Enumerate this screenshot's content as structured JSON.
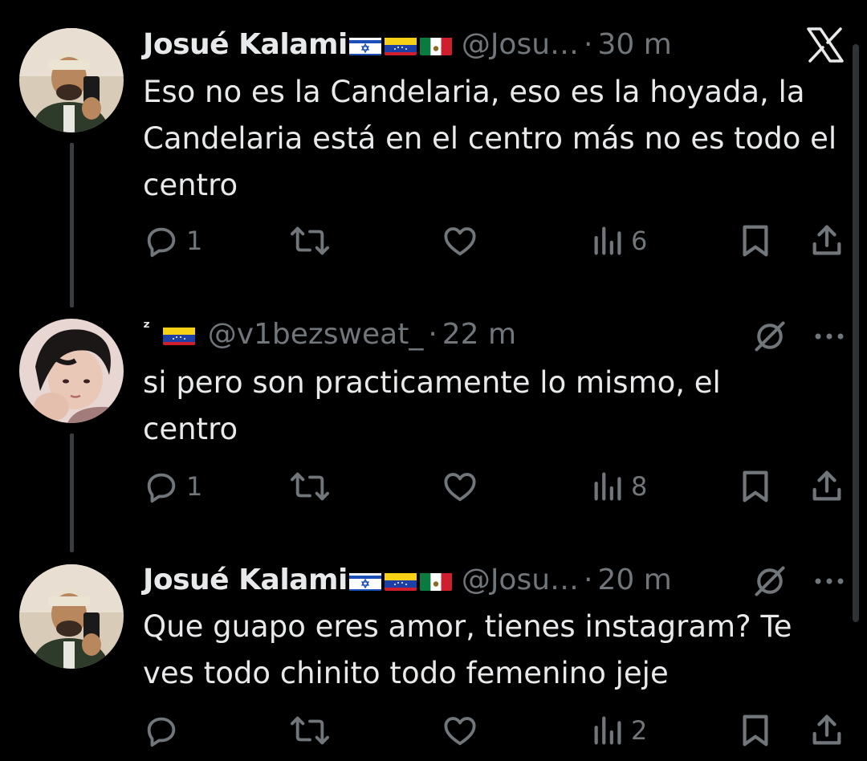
{
  "tweets": [
    {
      "name": "Josué Kalami",
      "handle": "@Josu…",
      "dot": "·",
      "time": "30 m",
      "text": "Eso no es la Candelaria, eso es la hoyada, la Candelaria está en el centro más no es todo el centro",
      "replies": "1",
      "retweets": "",
      "likes": "",
      "views": "6"
    },
    {
      "name": "ᶻ",
      "handle": "@v1bezsweat_",
      "dot": "·",
      "time": "22 m",
      "text": "si pero son practicamente lo mismo, el centro",
      "replies": "1",
      "retweets": "",
      "likes": "",
      "views": "8"
    },
    {
      "name": "Josué Kalami",
      "handle": "@Josu…",
      "dot": "·",
      "time": "20 m",
      "text": "Que guapo eres amor, tienes instagram? Te ves todo chinito todo femenino jeje",
      "replies": "",
      "retweets": "",
      "likes": "",
      "views": "2"
    }
  ],
  "icons": {
    "logo": "x-logo-icon",
    "grok": "grok-icon",
    "more": "more-icon",
    "reply": "reply-icon",
    "retweet": "retweet-icon",
    "like": "heart-icon",
    "views": "views-icon",
    "bookmark": "bookmark-icon",
    "share": "share-icon"
  },
  "colors": {
    "background": "#000000",
    "text": "#e7e9ea",
    "secondary": "#71767b",
    "thread_line": "#3a3d40"
  }
}
